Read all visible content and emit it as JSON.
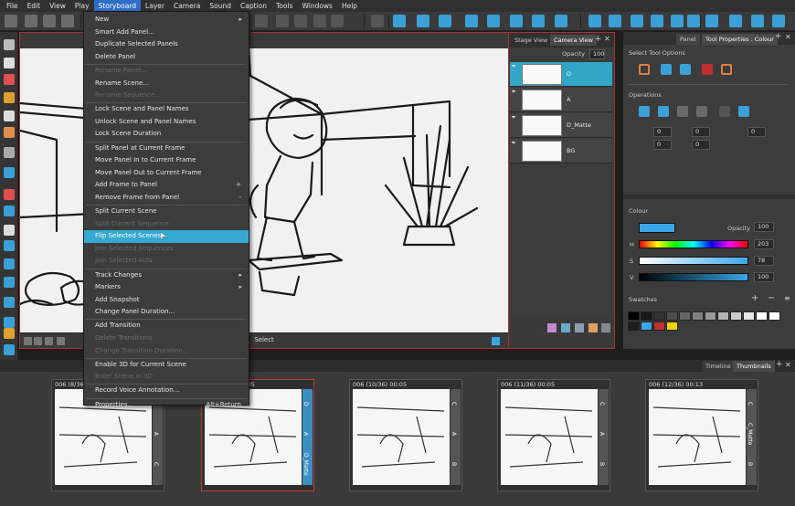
{
  "menubar": {
    "items": [
      "File",
      "Edit",
      "View",
      "Play",
      "Storyboard",
      "Layer",
      "Camera",
      "Sound",
      "Caption",
      "Tools",
      "Windows",
      "Help"
    ],
    "active": "Storyboard"
  },
  "storyboard_menu": {
    "items": [
      {
        "label": "New",
        "submenu": true,
        "enabled": true
      },
      {
        "label": "Smart Add Panel...",
        "enabled": true
      },
      {
        "label": "Duplicate Selected Panels",
        "enabled": true
      },
      {
        "label": "Delete Panel",
        "enabled": true,
        "sep_after": true
      },
      {
        "label": "Rename Panel...",
        "enabled": false
      },
      {
        "label": "Rename Scene...",
        "enabled": true
      },
      {
        "label": "Rename Sequence...",
        "enabled": false,
        "sep_after": true
      },
      {
        "label": "Lock Scene and Panel Names",
        "enabled": true
      },
      {
        "label": "Unlock Scene and Panel Names",
        "enabled": true
      },
      {
        "label": "Lock Scene Duration",
        "enabled": true,
        "sep_after": true
      },
      {
        "label": "Split Panel at Current Frame",
        "enabled": true
      },
      {
        "label": "Move Panel In to Current Frame",
        "enabled": true
      },
      {
        "label": "Move Panel Out to Current Frame",
        "enabled": true
      },
      {
        "label": "Add Frame to Panel",
        "shortcut": "+",
        "enabled": true
      },
      {
        "label": "Remove Frame from Panel",
        "shortcut": "-",
        "enabled": true,
        "sep_after": true
      },
      {
        "label": "Split Current Scene",
        "enabled": true
      },
      {
        "label": "Split Current Sequence",
        "enabled": false
      },
      {
        "label": "Flip Selected Scenes",
        "enabled": true,
        "highlighted": true
      },
      {
        "label": "Join Selected Sequences",
        "enabled": false
      },
      {
        "label": "Join Selected Acts",
        "enabled": false,
        "sep_after": true
      },
      {
        "label": "Track Changes",
        "submenu": true,
        "enabled": true
      },
      {
        "label": "Markers",
        "submenu": true,
        "enabled": true
      },
      {
        "label": "Add Snapshot",
        "enabled": true
      },
      {
        "label": "Change Panel Duration...",
        "enabled": true,
        "sep_after": true
      },
      {
        "label": "Add Transition",
        "enabled": true
      },
      {
        "label": "Delete Transitions",
        "enabled": false
      },
      {
        "label": "Change Transition Duration...",
        "enabled": false,
        "sep_after": true
      },
      {
        "label": "Enable 3D for Current Scene",
        "enabled": true
      },
      {
        "label": "Enter Scene in 3D",
        "enabled": false,
        "sep_after": true
      },
      {
        "label": "Record Voice Annotation...",
        "enabled": true,
        "sep_after": true
      },
      {
        "label": "Properties...",
        "shortcut": "Alt+Return",
        "enabled": true
      }
    ]
  },
  "stage": {
    "status": "Select"
  },
  "camera_panel": {
    "tabs": [
      "Stage View",
      "Camera View"
    ],
    "opacity_label": "Opacity",
    "opacity_value": "100",
    "layers": [
      {
        "name": "D",
        "selected": true
      },
      {
        "name": "A",
        "selected": false
      },
      {
        "name": "D_Matte",
        "selected": false
      },
      {
        "name": "BG",
        "selected": false
      }
    ]
  },
  "properties": {
    "tabs": [
      "Panel",
      "Tool Properties : Colour"
    ],
    "select_tool_options": "Select Tool Options",
    "operations": "Operations",
    "op_values": [
      "0",
      "0",
      "0",
      "0",
      "0",
      "0"
    ],
    "colour_label": "Colour",
    "opacity_label": "Opacity",
    "opacity_value": "100",
    "h_label": "H",
    "h_value": "203",
    "s_label": "S",
    "s_value": "78",
    "v_label": "V",
    "v_value": "100",
    "swatches_label": "Swatches",
    "current_colour": "#3aa8e8",
    "swatch_colors": [
      "#000000",
      "#1a1a1a",
      "#333333",
      "#4d4d4d",
      "#666666",
      "#808080",
      "#999999",
      "#b3b3b3",
      "#cccccc",
      "#e6e6e6",
      "#ffffff",
      "#ffffff",
      "#1c1c1c",
      "#3aa8e8",
      "#c23030",
      "#f2d200"
    ]
  },
  "thumbnails": {
    "tabs": [
      "Timeline",
      "Thumbnails"
    ],
    "panels": [
      {
        "header": "006 (8/36) 00:05",
        "side": [
          "C",
          "A",
          "C"
        ]
      },
      {
        "header": "006 (9/36) 00:05",
        "side": [
          "D",
          "A",
          "D_Matte"
        ],
        "selected": true
      },
      {
        "header": "006 (10/36) 00:05",
        "side": [
          "C",
          "A",
          "B"
        ]
      },
      {
        "header": "006 (11/36) 00:05",
        "side": [
          "C",
          "A",
          "B"
        ]
      },
      {
        "header": "006 (12/36) 00:13",
        "side": [
          "C",
          "C_Matte",
          "B"
        ]
      }
    ]
  }
}
